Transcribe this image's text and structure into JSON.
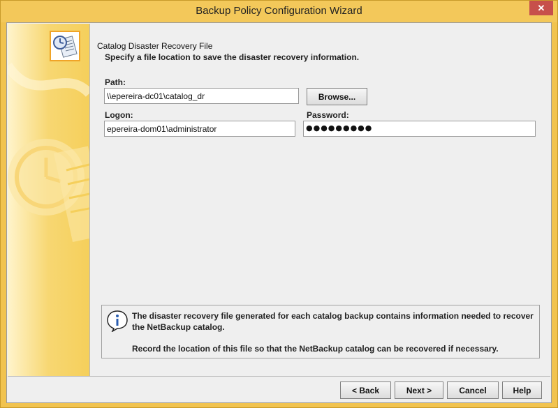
{
  "window": {
    "title": "Backup Policy Configuration Wizard",
    "close_glyph": "✕"
  },
  "page": {
    "title": "Catalog Disaster Recovery File",
    "subtitle": "Specify a file location to save the disaster recovery information."
  },
  "form": {
    "path_label": "Path:",
    "path_value": "\\\\epereira-dc01\\catalog_dr",
    "browse_label": "Browse...",
    "logon_label": "Logon:",
    "logon_value": "epereira-dom01\\administrator",
    "password_label": "Password:",
    "password_value": "●●●●●●●●●"
  },
  "info": {
    "text1": "The disaster recovery file generated for each catalog backup contains information needed to recover the NetBackup catalog.",
    "text2": "Record the location of this file so that the NetBackup catalog can be recovered if necessary."
  },
  "buttons": {
    "back_label": "< Back",
    "next_label": "Next >",
    "cancel_label": "Cancel",
    "help_label": "Help"
  },
  "colors": {
    "titlebar": "#f3c85a",
    "close": "#c7504b",
    "accent": "#f0a428"
  },
  "icons": {
    "wizard": "clock-document-icon",
    "info": "info-speech-bubble-icon",
    "close": "close-icon"
  }
}
